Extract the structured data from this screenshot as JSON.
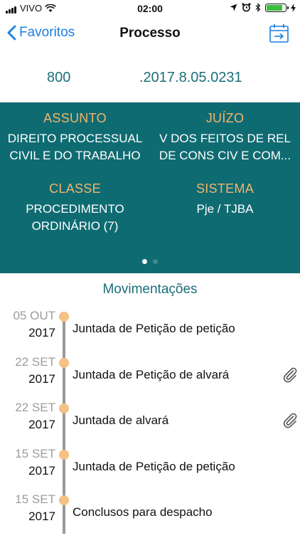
{
  "status_bar": {
    "carrier": "VIVO",
    "time": "02:00",
    "battery_color": "#3cbf3c"
  },
  "nav": {
    "back_label": "Favoritos",
    "title": "Processo"
  },
  "process_number": {
    "part1": "800",
    "part2": ".2017.8.05.0231"
  },
  "info_panel": {
    "background": "#0f6b72",
    "assunto": {
      "label": "ASSUNTO",
      "value": "DIREITO PROCESSUAL\nCIVIL E DO TRABALHO"
    },
    "juizo": {
      "label": "JUÍZO",
      "value": "V DOS FEITOS DE REL\nDE CONS CIV E COM..."
    },
    "classe": {
      "label": "CLASSE",
      "value": "PROCEDIMENTO\nORDINÁRIO (7)"
    },
    "sistema": {
      "label": "SISTEMA",
      "value": "Pje / TJBA"
    },
    "page_count": 2,
    "active_page": 1
  },
  "movimentacoes": {
    "title": "Movimentações",
    "items": [
      {
        "day": "05 OUT",
        "year": "2017",
        "description": "Juntada de Petição de petição",
        "has_attachment": false
      },
      {
        "day": "22 SET",
        "year": "2017",
        "description": "Juntada de Petição de alvará",
        "has_attachment": true
      },
      {
        "day": "22 SET",
        "year": "2017",
        "description": "Juntada de alvará",
        "has_attachment": true
      },
      {
        "day": "15 SET",
        "year": "2017",
        "description": "Juntada de Petição de petição",
        "has_attachment": false
      },
      {
        "day": "15 SET",
        "year": "2017",
        "description": "Conclusos para despacho",
        "has_attachment": false
      }
    ]
  },
  "icons": {
    "back": "chevron-left-icon",
    "calendar": "calendar-export-icon",
    "attachment": "paperclip-icon",
    "wifi": "wifi-icon",
    "location": "location-arrow-icon",
    "alarm": "alarm-clock-icon",
    "bluetooth": "bluetooth-icon",
    "charging": "charging-bolt-icon"
  }
}
